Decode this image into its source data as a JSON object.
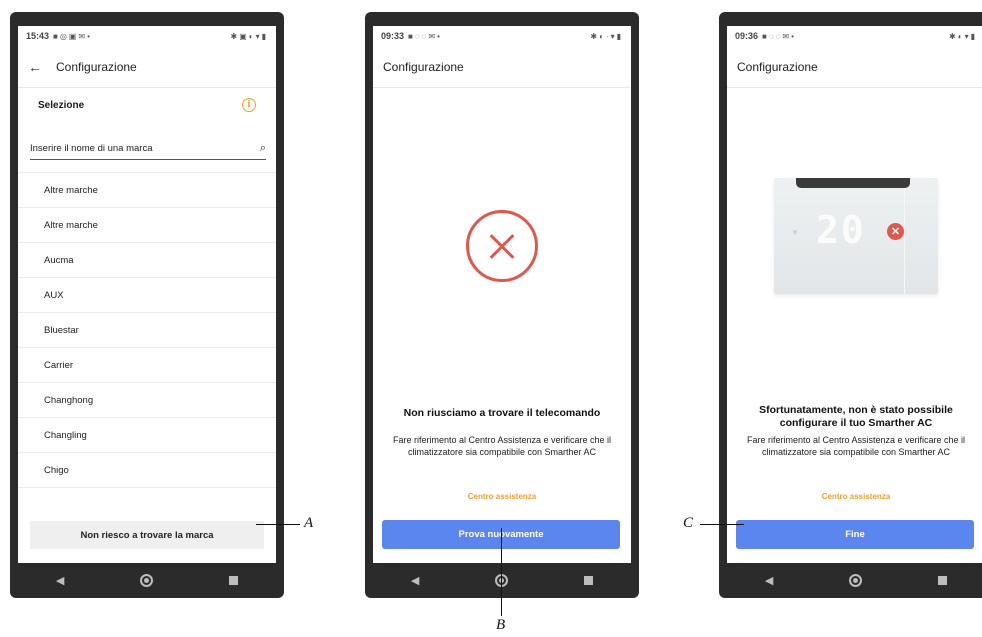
{
  "window_controls": {
    "popout_glyph": "⧉",
    "close_glyph": "✕"
  },
  "screen1": {
    "status_time": "15:43",
    "title": "Configurazione",
    "section_label": "Selezione",
    "search": {
      "placeholder": "Inserire il nome di una marca"
    },
    "brands": [
      "Altre marche",
      "Altre marche",
      "Aucma",
      "AUX",
      "Bluestar",
      "Carrier",
      "Changhong",
      "Changling",
      "Chigo"
    ],
    "not_found_button": "Non riesco a trovare la marca"
  },
  "screen2": {
    "status_time": "09:33",
    "title": "Configurazione",
    "message_title": "Non riusciamo a trovare il telecomando",
    "message_body": "Fare riferimento al Centro Assistenza e verificare che il climatizzatore sia compatibile con Smarther AC",
    "help_link": "Centro assistenza",
    "primary_button": "Prova nuovamente"
  },
  "screen3": {
    "status_time": "09:36",
    "title": "Configurazione",
    "thermostat_display": "20",
    "message_title": "Sfortunatamente, non è stato possibile configurare il tuo Smarther AC",
    "message_body": "Fare riferimento al Centro Assistenza e verificare che il climatizzatore sia compatibile con Smarther AC",
    "help_link": "Centro assistenza",
    "primary_button": "Fine"
  },
  "callouts": {
    "a": "A",
    "b": "B",
    "c": "C"
  },
  "colors": {
    "accent_button": "#5b86ee",
    "warning_orange": "#f0a030",
    "error_red": "#e2574c"
  },
  "icons": [
    "back-arrow-icon",
    "info-icon",
    "search-icon",
    "error-x-icon",
    "nav-back-icon",
    "nav-home-icon",
    "nav-recent-icon"
  ]
}
